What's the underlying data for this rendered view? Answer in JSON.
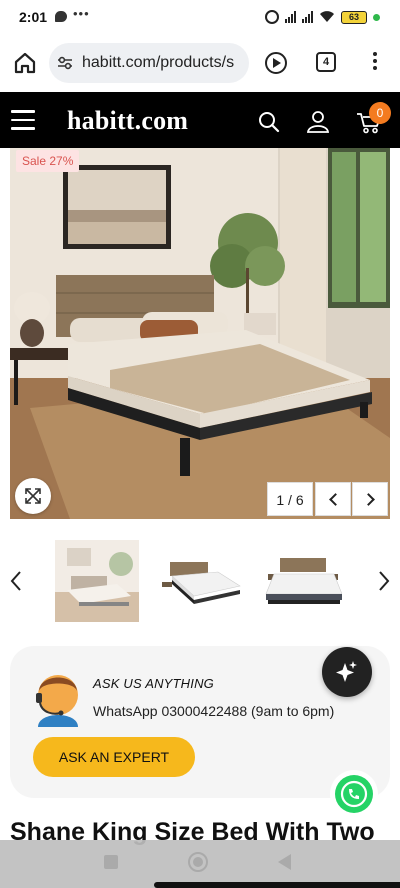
{
  "status_bar": {
    "time": "2:01",
    "battery": "63"
  },
  "browser": {
    "url": "habitt.com/products/s",
    "tab_count": "4"
  },
  "site": {
    "logo": "habitt.com",
    "cart_count": "0"
  },
  "product": {
    "sale_badge": "Sale 27%",
    "image_counter": "1 / 6",
    "title": "Shane King Size Bed With Two"
  },
  "ask_card": {
    "title": "ASK US ANYTHING",
    "whatsapp": "WhatsApp 03000422488 (9am to 6pm)",
    "button": "ASK AN EXPERT"
  },
  "colors": {
    "header_bg": "#000000",
    "cart_badge": "#f47b20",
    "sale_text": "#d9534f",
    "expert_button": "#f6b81c",
    "whatsapp_green": "#25d366"
  }
}
